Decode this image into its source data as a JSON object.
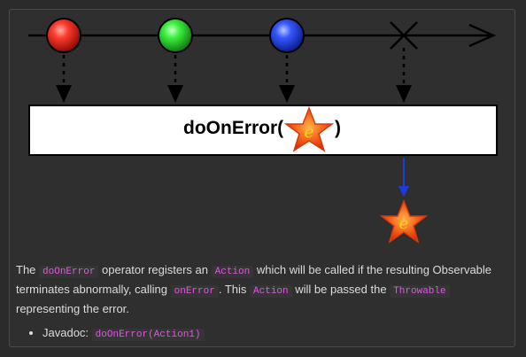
{
  "operator": {
    "name_prefix": "doOnError(",
    "name_suffix": ")",
    "star_glyph": "e"
  },
  "description": {
    "p1": "The ",
    "code1": "doOnError",
    "p2": " operator registers an ",
    "code2": "Action",
    "p3": " which will be called if the resulting Observable terminates abnormally, calling ",
    "code3": "onError",
    "p4": ". This ",
    "code4": "Action",
    "p5": " will be passed the ",
    "code5": "Throwable",
    "p6": " representing the error."
  },
  "javadoc": {
    "label": "Javadoc:",
    "code": "doOnError(Action1)"
  },
  "colors": {
    "red": "#e8261c",
    "green": "#2fd02f",
    "blue": "#2447e6",
    "star_fill": "#f25514",
    "star_glyph": "#f5d21c",
    "error_arrow": "#1f3be0",
    "code_text": "#e356e3"
  }
}
